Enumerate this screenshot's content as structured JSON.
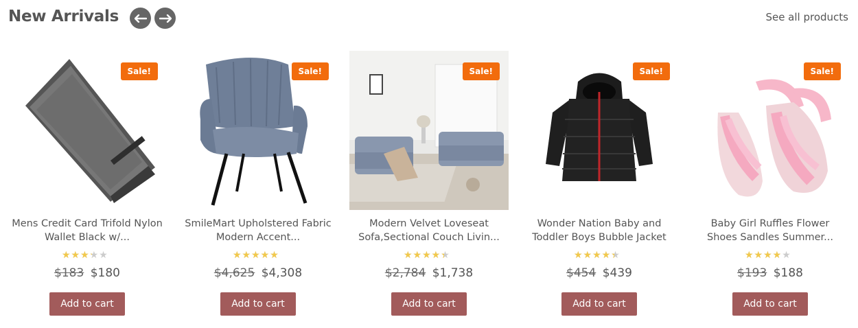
{
  "header": {
    "title": "New Arrivals",
    "prev_icon": "arrow-left-icon",
    "next_icon": "arrow-right-icon",
    "see_all": "See all products"
  },
  "products": [
    {
      "badge": "Sale!",
      "name": "Mens Credit Card Trifold Nylon Wallet Black w/...",
      "rating": 3,
      "old_price": "$183",
      "price": "$180",
      "button": "Add to cart"
    },
    {
      "badge": "Sale!",
      "name": "SmileMart Upholstered Fabric Modern Accent...",
      "rating": 4.5,
      "old_price": "$4,625",
      "price": "$4,308",
      "button": "Add to cart"
    },
    {
      "badge": "Sale!",
      "name": "Modern Velvet Loveseat Sofa,Sectional Couch Livin...",
      "rating": 4,
      "old_price": "$2,784",
      "price": "$1,738",
      "button": "Add to cart"
    },
    {
      "badge": "Sale!",
      "name": "Wonder Nation Baby and Toddler Boys Bubble Jacket",
      "rating": 4,
      "old_price": "$454",
      "price": "$439",
      "button": "Add to cart"
    },
    {
      "badge": "Sale!",
      "name": "Baby Girl Ruffles Flower Shoes Sandles Summer...",
      "rating": 3.5,
      "old_price": "$193",
      "price": "$188",
      "button": "Add to cart"
    }
  ],
  "colors": {
    "sale_badge": "#f26c0d",
    "button": "#a25b5b",
    "star": "#f2c94c"
  }
}
